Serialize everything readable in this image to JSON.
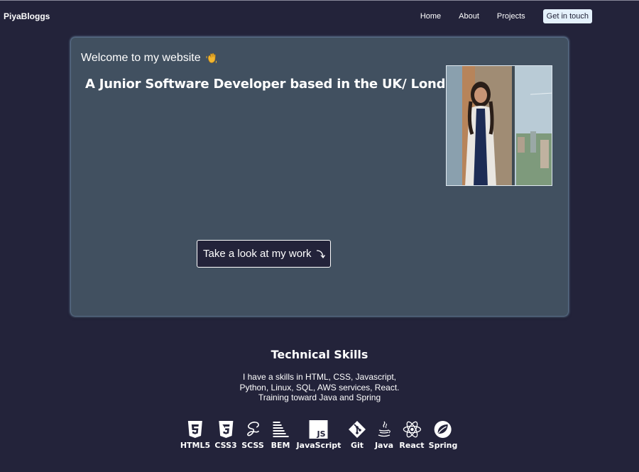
{
  "nav": {
    "brand": "PiyaBloggs",
    "items": [
      "Home",
      "About",
      "Projects"
    ],
    "cta": "Get in touch"
  },
  "hero": {
    "welcome": "Welcome to my website",
    "welcome_icon": "waving-hand-icon",
    "headline": "A Junior Software Developer based in the UK/ London",
    "button_label": "Take a look at my work",
    "button_icon": "curved-arrow-down-icon"
  },
  "skills": {
    "title": "Technical Skills",
    "description": "I have a skills in HTML, CSS, Javascript, Python, Linux, SQL, AWS services, React. Training toward Java and Spring",
    "items": [
      {
        "label": "HTML5",
        "icon": "html5-icon"
      },
      {
        "label": "CSS3",
        "icon": "css3-icon"
      },
      {
        "label": "SCSS",
        "icon": "sass-icon"
      },
      {
        "label": "BEM",
        "icon": "bem-icon"
      },
      {
        "label": "JavaScript",
        "icon": "javascript-icon"
      },
      {
        "label": "Git",
        "icon": "git-icon"
      },
      {
        "label": "Java",
        "icon": "java-icon"
      },
      {
        "label": "React",
        "icon": "react-icon"
      },
      {
        "label": "Spring",
        "icon": "spring-icon"
      }
    ]
  },
  "colors": {
    "background": "#23233a",
    "card": "#415060",
    "card_glow": "#7d9fbc",
    "cta_bg": "#e4f1fb"
  }
}
